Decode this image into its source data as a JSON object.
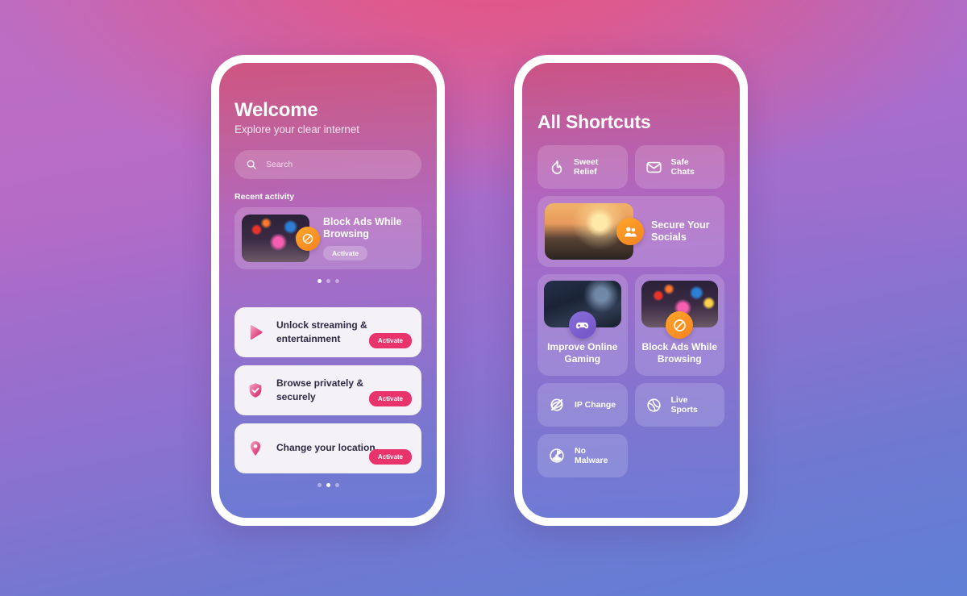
{
  "background": {
    "top_left": "#c068c0",
    "top_mid": "#e8557f",
    "top_right": "#a86fd0",
    "bottom": "#5f80d6"
  },
  "accent": {
    "pink": "#e8336b",
    "orange": "#f5821f",
    "purple": "#7352c6"
  },
  "phone_one": {
    "title": "Welcome",
    "subtitle": "Explore your clear internet",
    "search": {
      "placeholder": "Search",
      "icon": "search-icon"
    },
    "recent_label": "Recent activity",
    "recent_card": {
      "title": "Block Ads While Browsing",
      "button": "Activate",
      "badge_icon": "block-icon",
      "thumb": "times-square-photo"
    },
    "pager_top": {
      "count": 3,
      "active": 0
    },
    "features": [
      {
        "icon": "play-icon",
        "title": "Unlock streaming & entertainment",
        "button": "Activate"
      },
      {
        "icon": "shield-check-icon",
        "title": "Browse privately & securely",
        "button": "Activate"
      },
      {
        "icon": "location-pin-icon",
        "title": "Change your location",
        "button": "Activate"
      }
    ],
    "pager_bottom": {
      "count": 3,
      "active": 1
    }
  },
  "phone_two": {
    "title": "All Shortcuts",
    "chips_row1": [
      {
        "icon": "flame-icon",
        "label": "Sweet Relief"
      },
      {
        "icon": "envelope-icon",
        "label": "Safe Chats"
      }
    ],
    "wide_card": {
      "title": "Secure Your Socials",
      "badge_icon": "users-icon",
      "thumb": "city-sunset-photo"
    },
    "tiles": [
      {
        "title": "Improve Online Gaming",
        "badge_icon": "gamepad-icon",
        "thumb": "gaming-photo"
      },
      {
        "title": "Block Ads While Browsing",
        "badge_icon": "block-icon",
        "thumb": "times-square-photo"
      }
    ],
    "chips_row2": [
      {
        "icon": "globe-slash-icon",
        "label": "IP Change"
      },
      {
        "icon": "tennis-ball-icon",
        "label": "Live Sports"
      }
    ],
    "chips_row3": [
      {
        "icon": "radiation-icon",
        "label": "No Malware"
      }
    ]
  }
}
